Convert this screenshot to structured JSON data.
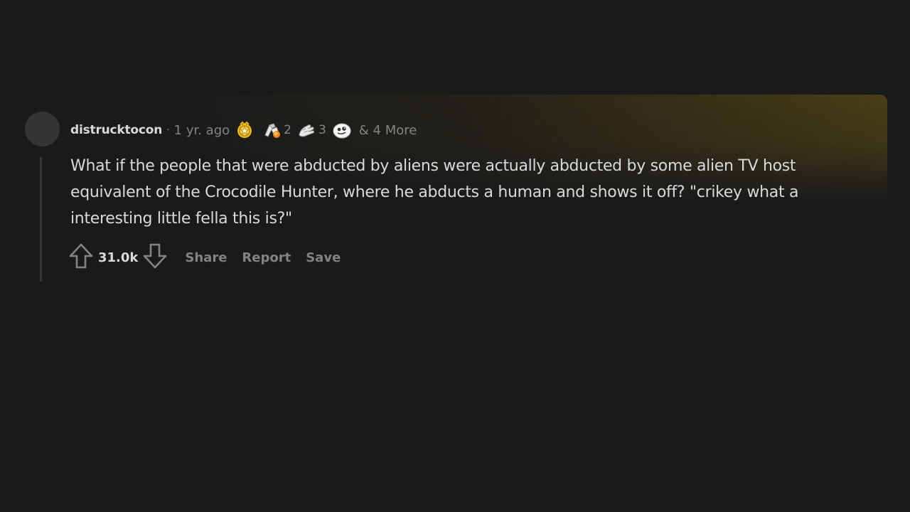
{
  "comment": {
    "username": "distrucktocon",
    "separator": "·",
    "age": "1 yr. ago",
    "awards": [
      {
        "icon": "gold-medal-icon",
        "count": ""
      },
      {
        "icon": "rocket-like-icon",
        "count": "2"
      },
      {
        "icon": "helping-hand-icon",
        "count": "3"
      },
      {
        "icon": "wholesome-face-icon",
        "count": ""
      }
    ],
    "more_awards": "& 4 More",
    "body": "What if the people that were abducted by aliens were actually abducted by some alien TV host equivalent of the Crocodile Hunter, where he abducts a human and shows it off? \"crikey what a interesting little fella this is?\"",
    "score": "31.0k",
    "actions": {
      "share": "Share",
      "report": "Report",
      "save": "Save"
    }
  },
  "colors": {
    "background": "#1a1a1b",
    "text": "#d7dadc",
    "muted": "#818384",
    "gold": "#e8b820"
  }
}
